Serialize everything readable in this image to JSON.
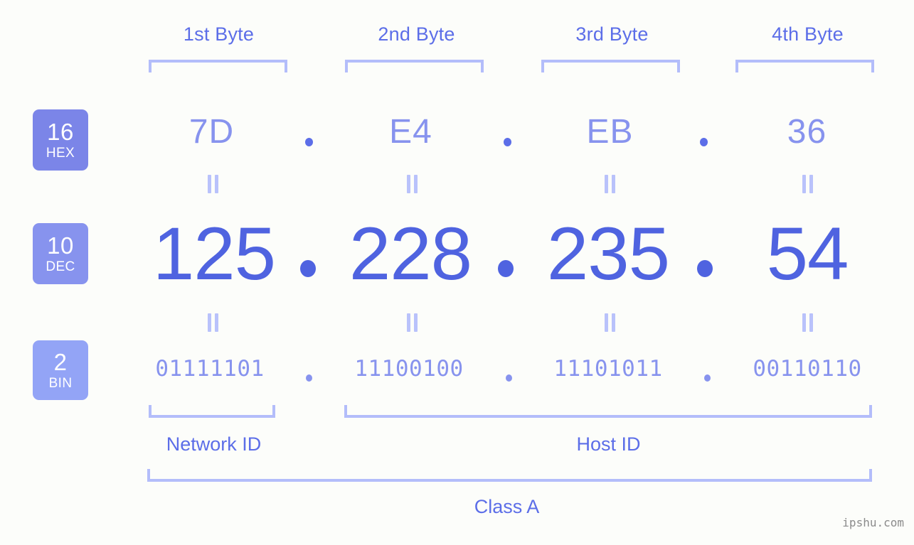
{
  "byte_headers": [
    {
      "label": "1st Byte"
    },
    {
      "label": "2nd Byte"
    },
    {
      "label": "3rd Byte"
    },
    {
      "label": "4th Byte"
    }
  ],
  "rows": {
    "hex": {
      "badge_num": "16",
      "badge_sub": "HEX",
      "badge_color": "#7b85e8",
      "values": [
        "7D",
        "E4",
        "EB",
        "36"
      ],
      "separator": "."
    },
    "dec": {
      "badge_num": "10",
      "badge_sub": "DEC",
      "badge_color": "#8793ee",
      "values": [
        "125",
        "228",
        "235",
        "54"
      ],
      "separator": "."
    },
    "bin": {
      "badge_num": "2",
      "badge_sub": "BIN",
      "badge_color": "#93a4f6",
      "values": [
        "01111101",
        "11100100",
        "11101011",
        "00110110"
      ],
      "separator": "."
    }
  },
  "equals_symbol": "=",
  "sections": {
    "network_id": "Network ID",
    "host_id": "Host ID",
    "class": "Class A"
  },
  "watermark": "ipshu.com",
  "colors": {
    "background": "#fcfdfa",
    "accent_strong": "#4f63e0",
    "accent_mid": "#5c6ee8",
    "accent_light": "#8793ee",
    "bracket": "#b3bdfa"
  }
}
